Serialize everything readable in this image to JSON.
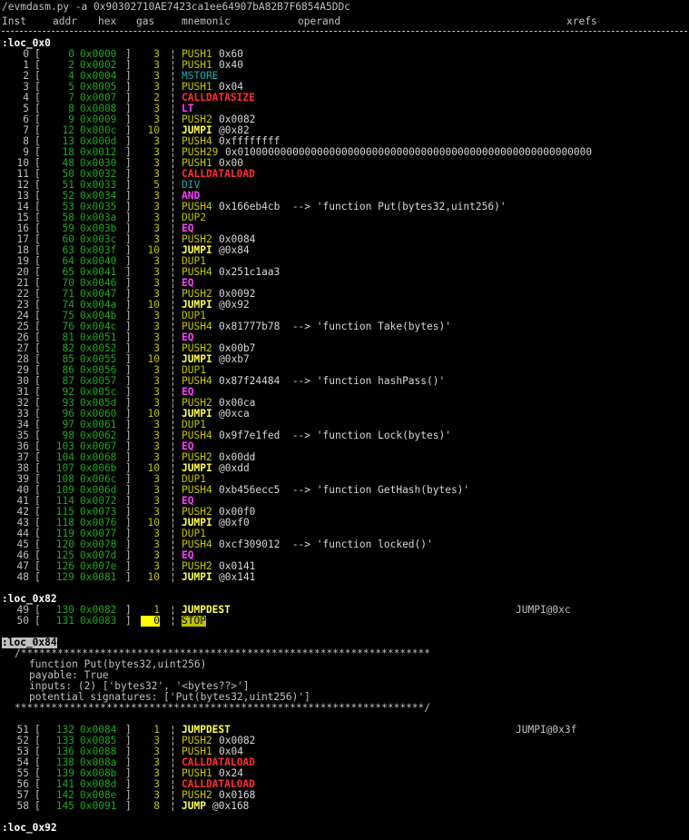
{
  "command": "/evmdasm.py -a 0x90302710AE7423ca1ee64907bA82B7F6854A5DDc",
  "columns": [
    "Inst",
    "addr",
    "hex",
    "gas",
    "mnemonic",
    "operand",
    "xrefs"
  ],
  "sections": [
    {
      "label": ":loc_0x0",
      "rows": [
        {
          "i": "0",
          "a": "0",
          "h": "0x0000",
          "g": "3",
          "m": "PUSH1",
          "c": "push",
          "o": "0x60"
        },
        {
          "i": "1",
          "a": "2",
          "h": "0x0002",
          "g": "3",
          "m": "PUSH1",
          "c": "push",
          "o": "0x40"
        },
        {
          "i": "2",
          "a": "4",
          "h": "0x0004",
          "g": "3",
          "m": "MSTORE",
          "c": "teal",
          "o": ""
        },
        {
          "i": "3",
          "a": "5",
          "h": "0x0005",
          "g": "3",
          "m": "PUSH1",
          "c": "push",
          "o": "0x04"
        },
        {
          "i": "4",
          "a": "7",
          "h": "0x0007",
          "g": "2",
          "m": "CALLDATASIZE",
          "c": "red",
          "o": ""
        },
        {
          "i": "5",
          "a": "8",
          "h": "0x0008",
          "g": "3",
          "m": "LT",
          "c": "mag",
          "o": ""
        },
        {
          "i": "6",
          "a": "9",
          "h": "0x0009",
          "g": "3",
          "m": "PUSH2",
          "c": "push",
          "o": "0x0082"
        },
        {
          "i": "7",
          "a": "12",
          "h": "0x000c",
          "g": "10",
          "m": "JUMPI",
          "c": "jump",
          "o": "@0x82"
        },
        {
          "i": "8",
          "a": "13",
          "h": "0x000d",
          "g": "3",
          "m": "PUSH4",
          "c": "push",
          "o": "0xffffffff"
        },
        {
          "i": "9",
          "a": "18",
          "h": "0x0012",
          "g": "3",
          "m": "PUSH29",
          "c": "push",
          "o": "0x0100000000000000000000000000000000000000000000000000000000"
        },
        {
          "i": "10",
          "a": "48",
          "h": "0x0030",
          "g": "3",
          "m": "PUSH1",
          "c": "push",
          "o": "0x00"
        },
        {
          "i": "11",
          "a": "50",
          "h": "0x0032",
          "g": "3",
          "m": "CALLDATALOAD",
          "c": "red",
          "o": ""
        },
        {
          "i": "12",
          "a": "51",
          "h": "0x0033",
          "g": "5",
          "m": "DIV",
          "c": "teal",
          "o": ""
        },
        {
          "i": "13",
          "a": "52",
          "h": "0x0034",
          "g": "3",
          "m": "AND",
          "c": "mag",
          "o": ""
        },
        {
          "i": "14",
          "a": "53",
          "h": "0x0035",
          "g": "3",
          "m": "PUSH4",
          "c": "push",
          "o": "0x166eb4cb  --> 'function Put(bytes32,uint256)'"
        },
        {
          "i": "15",
          "a": "58",
          "h": "0x003a",
          "g": "3",
          "m": "DUP2",
          "c": "dup",
          "o": ""
        },
        {
          "i": "16",
          "a": "59",
          "h": "0x003b",
          "g": "3",
          "m": "EQ",
          "c": "mag",
          "o": ""
        },
        {
          "i": "17",
          "a": "60",
          "h": "0x003c",
          "g": "3",
          "m": "PUSH2",
          "c": "push",
          "o": "0x0084"
        },
        {
          "i": "18",
          "a": "63",
          "h": "0x003f",
          "g": "10",
          "m": "JUMPI",
          "c": "jump",
          "o": "@0x84"
        },
        {
          "i": "19",
          "a": "64",
          "h": "0x0040",
          "g": "3",
          "m": "DUP1",
          "c": "dup",
          "o": ""
        },
        {
          "i": "20",
          "a": "65",
          "h": "0x0041",
          "g": "3",
          "m": "PUSH4",
          "c": "push",
          "o": "0x251c1aa3"
        },
        {
          "i": "21",
          "a": "70",
          "h": "0x0046",
          "g": "3",
          "m": "EQ",
          "c": "mag",
          "o": ""
        },
        {
          "i": "22",
          "a": "71",
          "h": "0x0047",
          "g": "3",
          "m": "PUSH2",
          "c": "push",
          "o": "0x0092"
        },
        {
          "i": "23",
          "a": "74",
          "h": "0x004a",
          "g": "10",
          "m": "JUMPI",
          "c": "jump",
          "o": "@0x92"
        },
        {
          "i": "24",
          "a": "75",
          "h": "0x004b",
          "g": "3",
          "m": "DUP1",
          "c": "dup",
          "o": ""
        },
        {
          "i": "25",
          "a": "76",
          "h": "0x004c",
          "g": "3",
          "m": "PUSH4",
          "c": "push",
          "o": "0x81777b78  --> 'function Take(bytes)'"
        },
        {
          "i": "26",
          "a": "81",
          "h": "0x0051",
          "g": "3",
          "m": "EQ",
          "c": "mag",
          "o": ""
        },
        {
          "i": "27",
          "a": "82",
          "h": "0x0052",
          "g": "3",
          "m": "PUSH2",
          "c": "push",
          "o": "0x00b7"
        },
        {
          "i": "28",
          "a": "85",
          "h": "0x0055",
          "g": "10",
          "m": "JUMPI",
          "c": "jump",
          "o": "@0xb7"
        },
        {
          "i": "29",
          "a": "86",
          "h": "0x0056",
          "g": "3",
          "m": "DUP1",
          "c": "dup",
          "o": ""
        },
        {
          "i": "30",
          "a": "87",
          "h": "0x0057",
          "g": "3",
          "m": "PUSH4",
          "c": "push",
          "o": "0x87f24484  --> 'function hashPass()'"
        },
        {
          "i": "31",
          "a": "92",
          "h": "0x005c",
          "g": "3",
          "m": "EQ",
          "c": "mag",
          "o": ""
        },
        {
          "i": "32",
          "a": "93",
          "h": "0x005d",
          "g": "3",
          "m": "PUSH2",
          "c": "push",
          "o": "0x00ca"
        },
        {
          "i": "33",
          "a": "96",
          "h": "0x0060",
          "g": "10",
          "m": "JUMPI",
          "c": "jump",
          "o": "@0xca"
        },
        {
          "i": "34",
          "a": "97",
          "h": "0x0061",
          "g": "3",
          "m": "DUP1",
          "c": "dup",
          "o": ""
        },
        {
          "i": "35",
          "a": "98",
          "h": "0x0062",
          "g": "3",
          "m": "PUSH4",
          "c": "push",
          "o": "0x9f7e1fed  --> 'function Lock(bytes)'"
        },
        {
          "i": "36",
          "a": "103",
          "h": "0x0067",
          "g": "3",
          "m": "EQ",
          "c": "mag",
          "o": ""
        },
        {
          "i": "37",
          "a": "104",
          "h": "0x0068",
          "g": "3",
          "m": "PUSH2",
          "c": "push",
          "o": "0x00dd"
        },
        {
          "i": "38",
          "a": "107",
          "h": "0x006b",
          "g": "10",
          "m": "JUMPI",
          "c": "jump",
          "o": "@0xdd"
        },
        {
          "i": "39",
          "a": "108",
          "h": "0x006c",
          "g": "3",
          "m": "DUP1",
          "c": "dup",
          "o": ""
        },
        {
          "i": "40",
          "a": "109",
          "h": "0x006d",
          "g": "3",
          "m": "PUSH4",
          "c": "push",
          "o": "0xb456ecc5  --> 'function GetHash(bytes)'"
        },
        {
          "i": "41",
          "a": "114",
          "h": "0x0072",
          "g": "3",
          "m": "EQ",
          "c": "mag",
          "o": ""
        },
        {
          "i": "42",
          "a": "115",
          "h": "0x0073",
          "g": "3",
          "m": "PUSH2",
          "c": "push",
          "o": "0x00f0"
        },
        {
          "i": "43",
          "a": "118",
          "h": "0x0076",
          "g": "10",
          "m": "JUMPI",
          "c": "jump",
          "o": "@0xf0"
        },
        {
          "i": "44",
          "a": "119",
          "h": "0x0077",
          "g": "3",
          "m": "DUP1",
          "c": "dup",
          "o": ""
        },
        {
          "i": "45",
          "a": "120",
          "h": "0x0078",
          "g": "3",
          "m": "PUSH4",
          "c": "push",
          "o": "0xcf309012  --> 'function locked()'"
        },
        {
          "i": "46",
          "a": "125",
          "h": "0x007d",
          "g": "3",
          "m": "EQ",
          "c": "mag",
          "o": ""
        },
        {
          "i": "47",
          "a": "126",
          "h": "0x007e",
          "g": "3",
          "m": "PUSH2",
          "c": "push",
          "o": "0x0141"
        },
        {
          "i": "48",
          "a": "129",
          "h": "0x0081",
          "g": "10",
          "m": "JUMPI",
          "c": "jump",
          "o": "@0x141"
        }
      ]
    },
    {
      "label": ":loc_0x82",
      "rows": [
        {
          "i": "49",
          "a": "130",
          "h": "0x0082",
          "g": "1",
          "m": "JUMPDEST",
          "c": "jump",
          "o": "",
          "x": "JUMPI@0xc"
        },
        {
          "i": "50",
          "a": "131",
          "h": "0x0083",
          "g": "0",
          "m": "STOP",
          "c": "stop",
          "o": "",
          "gh": true
        }
      ]
    },
    {
      "label": ":loc_0x84",
      "hl": true,
      "comment": [
        "/*******************************************************************",
        "function Put(bytes32,uint256)",
        "payable: True",
        "inputs: (2) ['bytes32', '<bytes??>']",
        "potential signatures: ['Put(bytes32,uint256)']",
        "*******************************************************************/"
      ],
      "rows": [
        {
          "i": "51",
          "a": "132",
          "h": "0x0084",
          "g": "1",
          "m": "JUMPDEST",
          "c": "jump",
          "o": "",
          "x": "JUMPI@0x3f"
        },
        {
          "i": "52",
          "a": "133",
          "h": "0x0085",
          "g": "3",
          "m": "PUSH2",
          "c": "push",
          "o": "0x0082"
        },
        {
          "i": "53",
          "a": "136",
          "h": "0x0088",
          "g": "3",
          "m": "PUSH1",
          "c": "push",
          "o": "0x04"
        },
        {
          "i": "54",
          "a": "138",
          "h": "0x008a",
          "g": "3",
          "m": "CALLDATALOAD",
          "c": "red",
          "o": ""
        },
        {
          "i": "55",
          "a": "139",
          "h": "0x008b",
          "g": "3",
          "m": "PUSH1",
          "c": "push",
          "o": "0x24"
        },
        {
          "i": "56",
          "a": "141",
          "h": "0x008d",
          "g": "3",
          "m": "CALLDATALOAD",
          "c": "red",
          "o": ""
        },
        {
          "i": "57",
          "a": "142",
          "h": "0x008e",
          "g": "3",
          "m": "PUSH2",
          "c": "push",
          "o": "0x0168"
        },
        {
          "i": "58",
          "a": "145",
          "h": "0x0091",
          "g": "8",
          "m": "JUMP",
          "c": "jump",
          "o": "@0x168"
        }
      ]
    },
    {
      "label": ":loc_0x92",
      "rows": []
    }
  ]
}
